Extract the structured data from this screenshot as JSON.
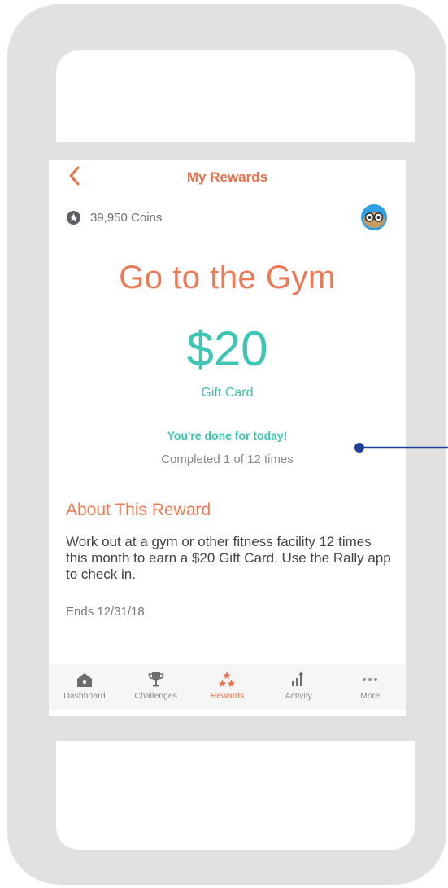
{
  "nav": {
    "title": "My Rewards"
  },
  "coins": {
    "label": "39,950 Coins"
  },
  "reward": {
    "title": "Go to the Gym",
    "amount": "$20",
    "amount_type": "Gift Card",
    "status": "You're done for today!",
    "progress_text": "Completed 1 of 12 times",
    "progress_completed": 1,
    "progress_total": 12
  },
  "about": {
    "heading": "About This Reward",
    "body": "Work out at a gym or other fitness facility 12 times this month to earn a $20 Gift Card. Use the Rally app to check in.",
    "ends": "Ends 12/31/18"
  },
  "tabs": [
    {
      "label": "Dashboard",
      "icon": "home-icon",
      "active": false
    },
    {
      "label": "Challenges",
      "icon": "trophy-icon",
      "active": false
    },
    {
      "label": "Rewards",
      "icon": "stars-icon",
      "active": true
    },
    {
      "label": "Activity",
      "icon": "bar-chart-icon",
      "active": false
    },
    {
      "label": "More",
      "icon": "more-dots-icon",
      "active": false
    }
  ],
  "colors": {
    "accent_orange": "#e8704a",
    "accent_teal": "#3dc6b3",
    "callout_blue": "#1f3f9a",
    "avatar_blue": "#2f9ee3"
  }
}
